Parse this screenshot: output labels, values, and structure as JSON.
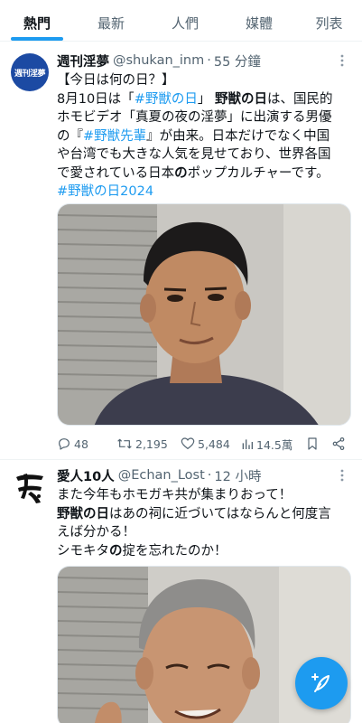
{
  "tabs": [
    {
      "label": "熱門",
      "active": true
    },
    {
      "label": "最新",
      "active": false
    },
    {
      "label": "人們",
      "active": false
    },
    {
      "label": "媒體",
      "active": false
    },
    {
      "label": "列表",
      "active": false
    }
  ],
  "tweets": [
    {
      "avatar_text": "週刊淫夢",
      "display_name": "週刊淫夢",
      "handle": "@shukan_inm",
      "separator": "·",
      "time": "55 分鐘",
      "body": {
        "line1": "【今日は何の日？】",
        "line2_a": "8月10日は「",
        "line2_link": "#野獣の日",
        "line2_b": "」 ",
        "line2_bold": "野獣の日",
        "line2_c": "は、国民的",
        "line3_a": "ホモビデオ「",
        "line3_bold": "真夏の夜の淫夢",
        "line3_b": "」に出演する男優",
        "line4_a": "の『",
        "line4_link": "#野獣先輩",
        "line4_b": "』が由来。日本だけでなく中国",
        "line5": "や台湾でも大きな人気を見せており、世界各国",
        "line6_a": "で愛されている日本",
        "line6_bold": "の",
        "line6_b": "ポップカルチャーです。",
        "hashtag": "#野獣の日2024"
      },
      "stats": {
        "replies": "48",
        "retweets": "2,195",
        "likes": "5,484",
        "views": "14.5萬"
      }
    },
    {
      "display_name": "愛人10人",
      "handle": "@Echan_Lost",
      "separator": "·",
      "time": "12 小時",
      "body": {
        "line1": "また今年もホモガキ共が集まりおって！",
        "line2_bold": "野獣の日",
        "line2_b": "はあの祠に近づいてはならんと何度言",
        "line3": "えば分かる！",
        "line4_a": "シモキタ",
        "line4_bold": "の",
        "line4_b": "掟を忘れたのか！"
      }
    }
  ],
  "icons": {
    "more": "more-vertical-icon",
    "reply": "reply-icon",
    "retweet": "retweet-icon",
    "like": "heart-icon",
    "views": "views-chart-icon",
    "bookmark": "bookmark-icon",
    "share": "share-icon",
    "compose": "compose-feather-icon"
  },
  "colors": {
    "accent": "#1d9bf0",
    "text": "#0f1419",
    "secondary": "#536471"
  }
}
